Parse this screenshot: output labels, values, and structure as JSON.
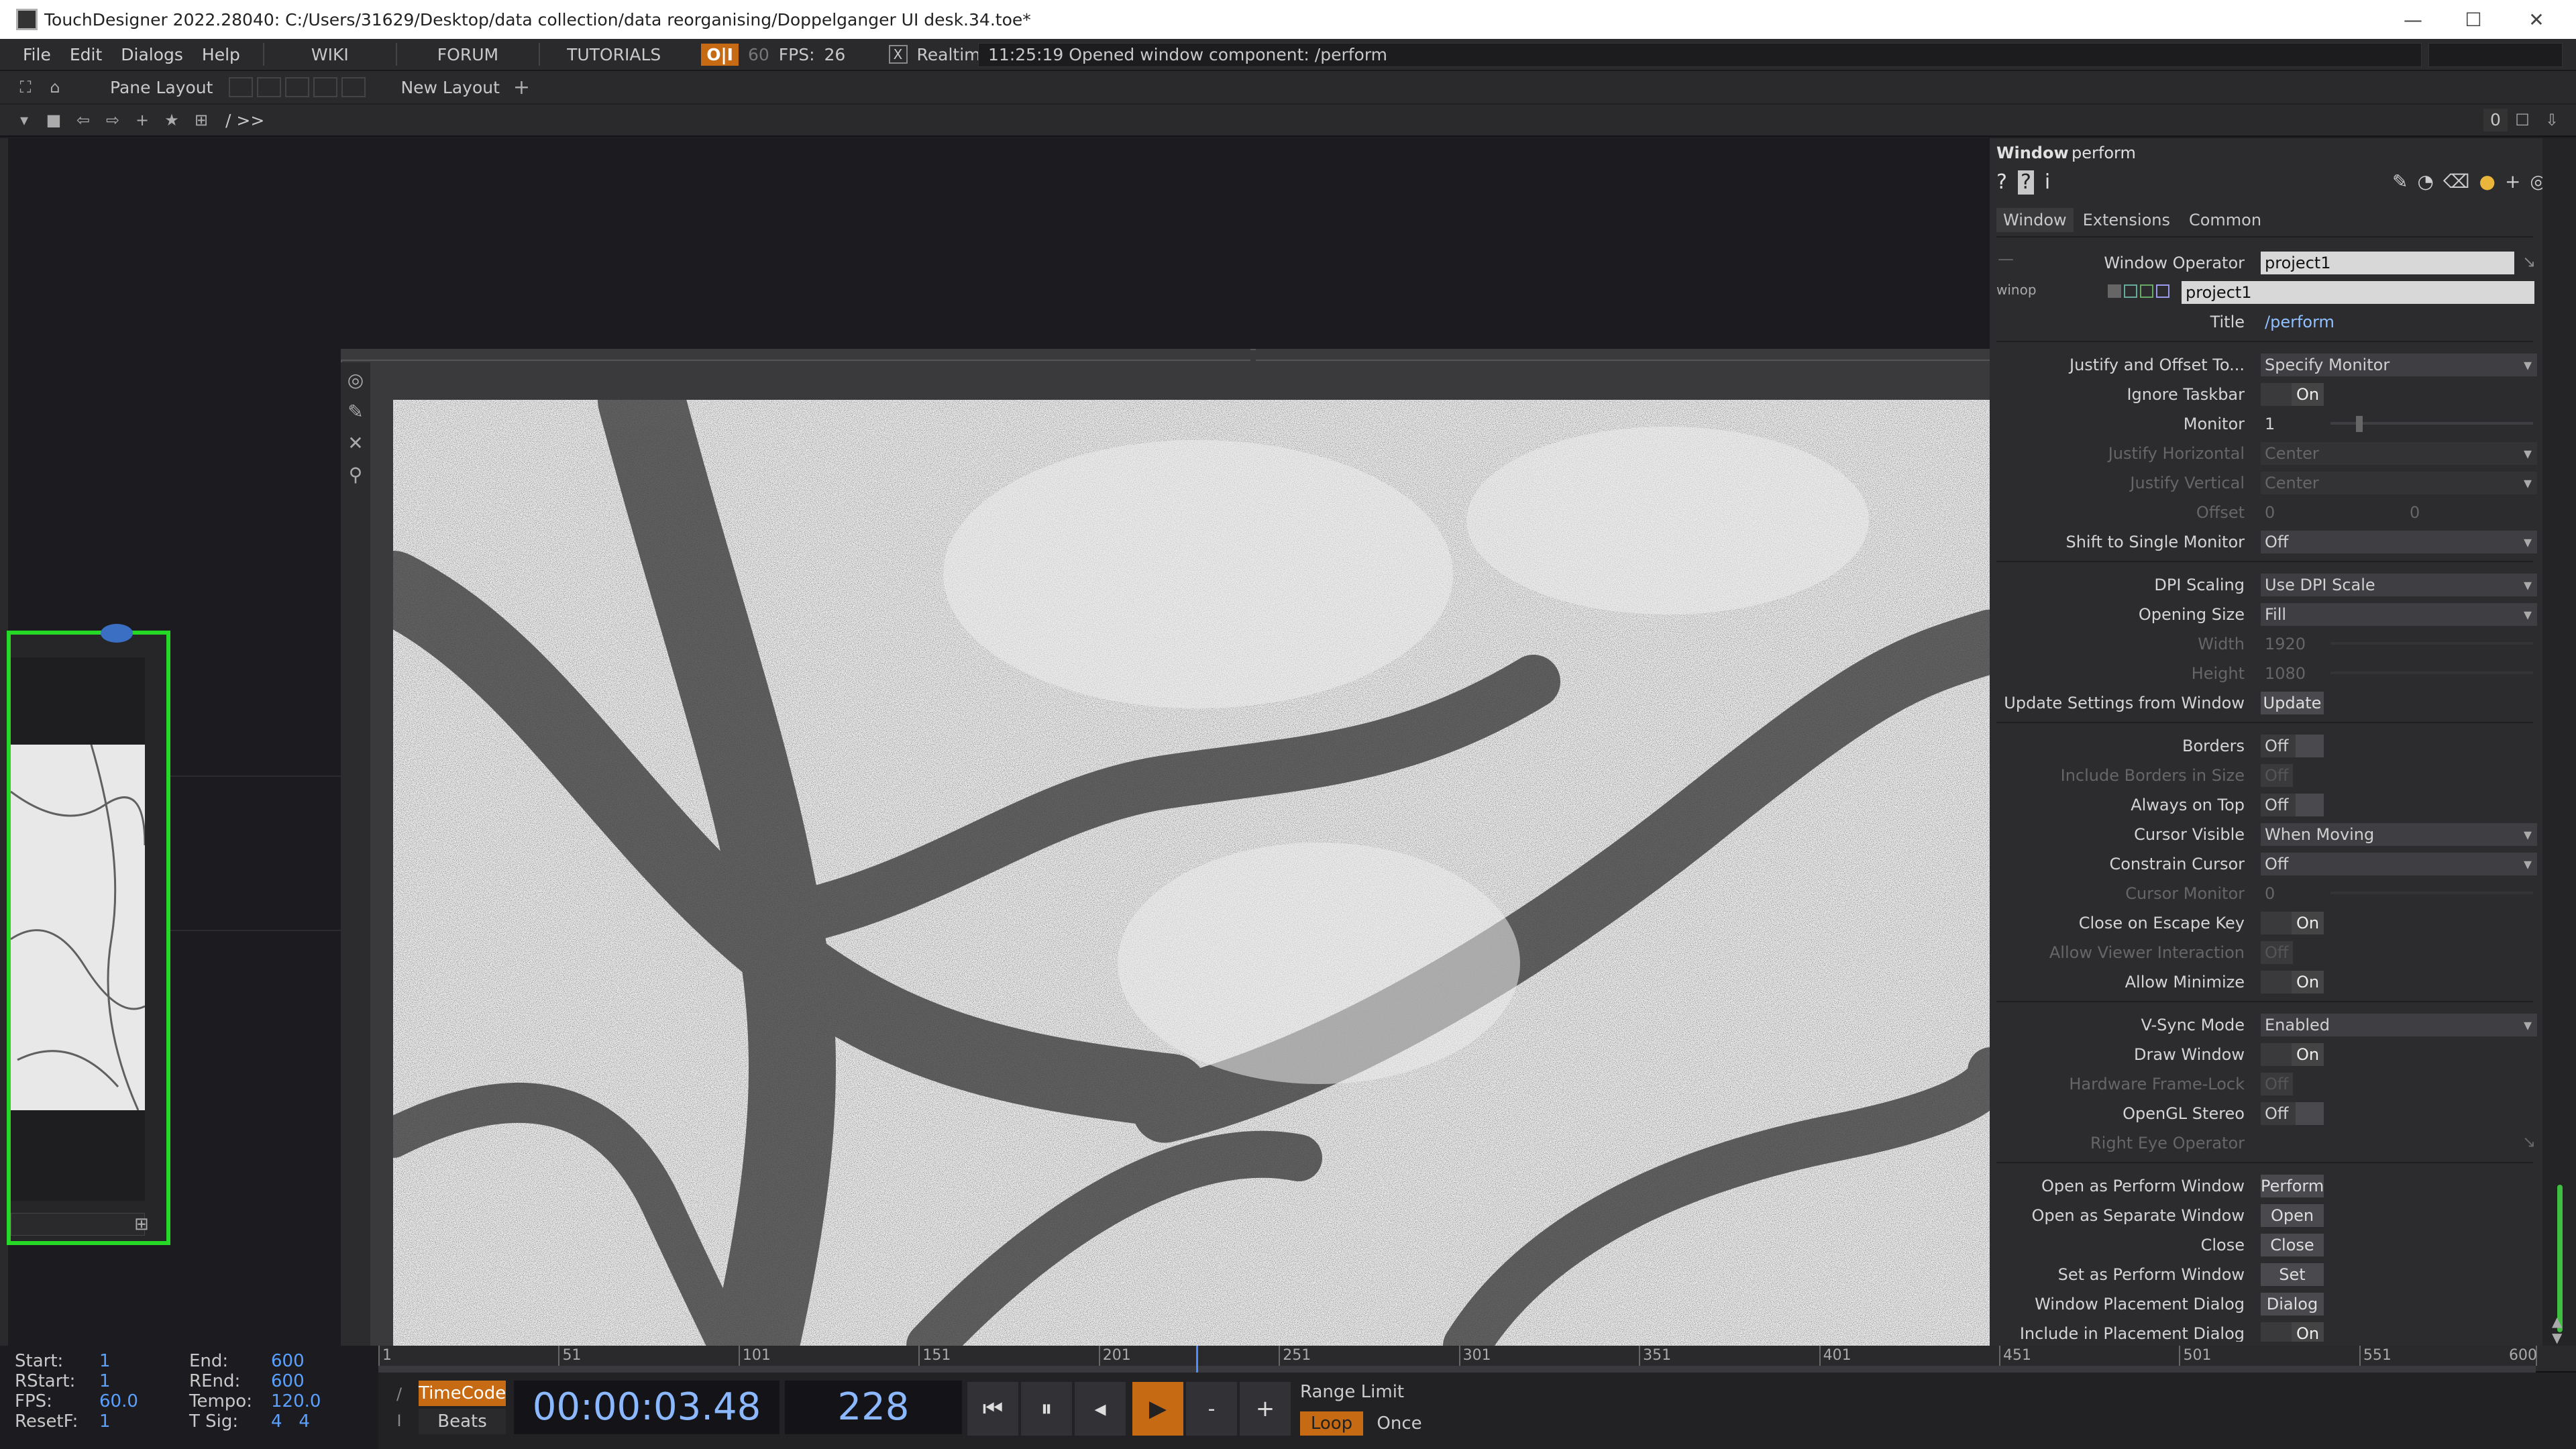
{
  "titlebar": {
    "title": "TouchDesigner 2022.28040: C:/Users/31629/Desktop/data collection/data reorganising/Doppelganger UI desk.34.toe*",
    "minimize": "—",
    "maximize": "☐",
    "close": "✕"
  },
  "menu": {
    "items": [
      "File",
      "Edit",
      "Dialogs",
      "Help"
    ],
    "tabs": [
      "WIKI",
      "FORUM",
      "TUTORIALS"
    ],
    "oi": "O|I",
    "fps_target": "60",
    "fps_label": "FPS:",
    "fps_value": "26",
    "realtime_check": "X",
    "realtime": "Realtime",
    "status": "11:25:19 Opened window component: /perform"
  },
  "panebar": {
    "pane_layout": "Pane Layout",
    "new_layout": "New Layout",
    "add": "+"
  },
  "netbar": {
    "path": "/ >>",
    "counter": "0"
  },
  "params": {
    "op_type": "Window",
    "op_name": "perform",
    "tabs": [
      "Window",
      "Extensions",
      "Common"
    ],
    "winop": "winop",
    "rows": {
      "window_operator": {
        "label": "Window Operator",
        "value": "project1"
      },
      "winop_value": "project1",
      "title": {
        "label": "Title",
        "value": "/perform"
      },
      "justify_offset": {
        "label": "Justify and Offset To...",
        "value": "Specify Monitor"
      },
      "ignore_taskbar": {
        "label": "Ignore Taskbar",
        "value": "On"
      },
      "monitor": {
        "label": "Monitor",
        "value": "1"
      },
      "justify_h": {
        "label": "Justify Horizontal",
        "value": "Center"
      },
      "justify_v": {
        "label": "Justify Vertical",
        "value": "Center"
      },
      "offset": {
        "label": "Offset",
        "value1": "0",
        "value2": "0"
      },
      "shift_single": {
        "label": "Shift to Single Monitor",
        "value": "Off"
      },
      "dpi_scaling": {
        "label": "DPI Scaling",
        "value": "Use DPI Scale"
      },
      "opening_size": {
        "label": "Opening Size",
        "value": "Fill"
      },
      "width": {
        "label": "Width",
        "value": "1920"
      },
      "height": {
        "label": "Height",
        "value": "1080"
      },
      "update_settings": {
        "label": "Update Settings from Window",
        "value": "Update"
      },
      "borders": {
        "label": "Borders",
        "value": "Off"
      },
      "include_borders": {
        "label": "Include Borders in Size",
        "value": "Off"
      },
      "always_on_top": {
        "label": "Always on Top",
        "value": "Off"
      },
      "cursor_visible": {
        "label": "Cursor Visible",
        "value": "When Moving"
      },
      "constrain_cursor": {
        "label": "Constrain Cursor",
        "value": "Off"
      },
      "cursor_monitor": {
        "label": "Cursor Monitor",
        "value": "0"
      },
      "close_escape": {
        "label": "Close on Escape Key",
        "value": "On"
      },
      "allow_viewer": {
        "label": "Allow Viewer Interaction",
        "value": "Off"
      },
      "allow_minimize": {
        "label": "Allow Minimize",
        "value": "On"
      },
      "vsync": {
        "label": "V-Sync Mode",
        "value": "Enabled"
      },
      "draw_window": {
        "label": "Draw Window",
        "value": "On"
      },
      "hw_framelock": {
        "label": "Hardware Frame-Lock",
        "value": "Off"
      },
      "opengl_stereo": {
        "label": "OpenGL Stereo",
        "value": "Off"
      },
      "right_eye": {
        "label": "Right Eye Operator",
        "value": ""
      },
      "open_perform": {
        "label": "Open as Perform Window",
        "value": "Perform"
      },
      "open_separate": {
        "label": "Open as Separate Window",
        "value": "Open"
      },
      "close": {
        "label": "Close",
        "value": "Close"
      },
      "set_perform": {
        "label": "Set as Perform Window",
        "value": "Set"
      },
      "placement_dialog": {
        "label": "Window Placement Dialog",
        "value": "Dialog"
      },
      "include_placement": {
        "label": "Include in Placement Dialog",
        "value": "On"
      }
    }
  },
  "stats": {
    "start": {
      "k": "Start:",
      "v": "1"
    },
    "rstart": {
      "k": "RStart:",
      "v": "1"
    },
    "fps": {
      "k": "FPS:",
      "v": "60.0"
    },
    "resetf": {
      "k": "ResetF:",
      "v": "1"
    },
    "end": {
      "k": "End:",
      "v": "600"
    },
    "rend": {
      "k": "REnd:",
      "v": "600"
    },
    "tempo": {
      "k": "Tempo:",
      "v": "120.0"
    },
    "tsig": {
      "k": "T Sig:",
      "v": "4   4"
    }
  },
  "timeline": {
    "ticks": [
      "1",
      "51",
      "101",
      "151",
      "201",
      "251",
      "301",
      "351",
      "401",
      "451",
      "501",
      "551",
      "600"
    ],
    "timecode_btn": "TimeCode",
    "beats_btn": "Beats",
    "timecode": "00:00:03.48",
    "frame": "228",
    "range_limit": "Range Limit",
    "loop": "Loop",
    "once": "Once",
    "playhead_frame": 228
  },
  "colors": {
    "accent_orange": "#c76a14",
    "node_green": "#27d927",
    "value_blue": "#5aa0ff"
  }
}
